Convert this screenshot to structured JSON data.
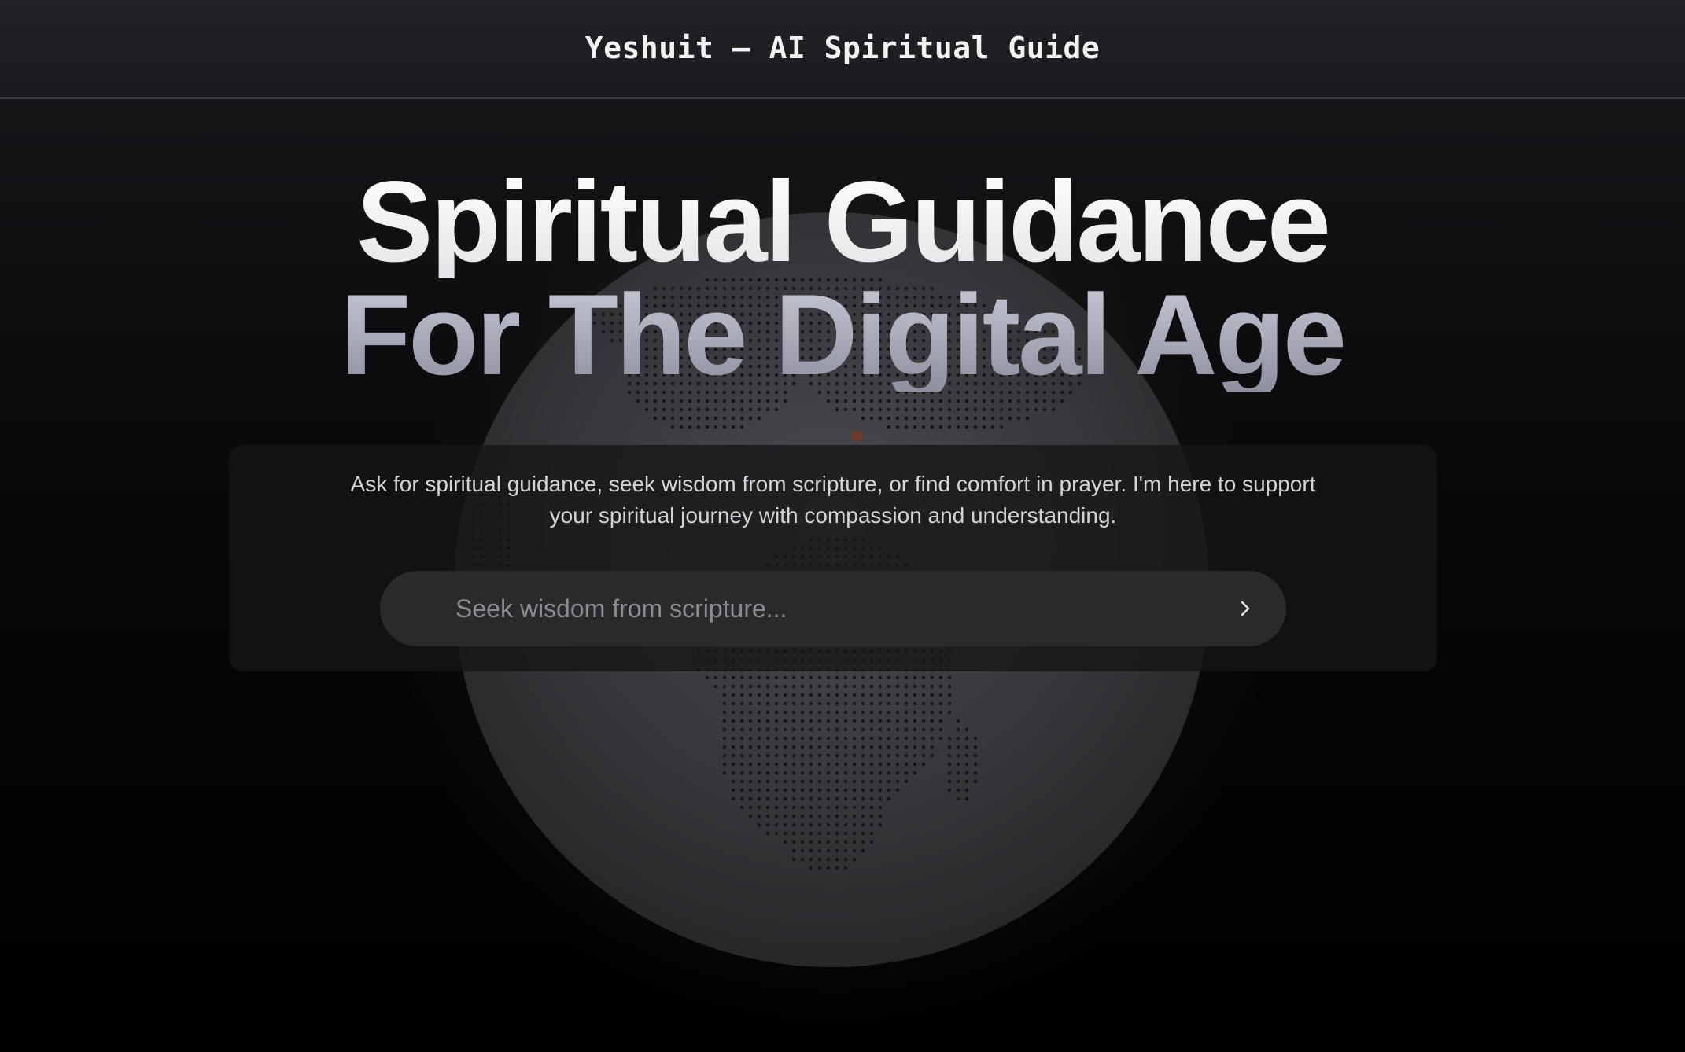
{
  "header": {
    "title": "Yeshuit – AI Spiritual Guide"
  },
  "hero": {
    "line1": "Spiritual Guidance",
    "line2": "For The Digital Age"
  },
  "intro": {
    "text": "Ask for spiritual guidance, seek wisdom from scripture, or find comfort in prayer. I'm here to support your spiritual journey with compassion and understanding."
  },
  "search": {
    "placeholder": "Seek wisdom from scripture...",
    "value": "",
    "submit_icon": "chevron-right-icon"
  },
  "background": {
    "graphic": "dotted-globe",
    "marker_color": "#7a3a22"
  }
}
